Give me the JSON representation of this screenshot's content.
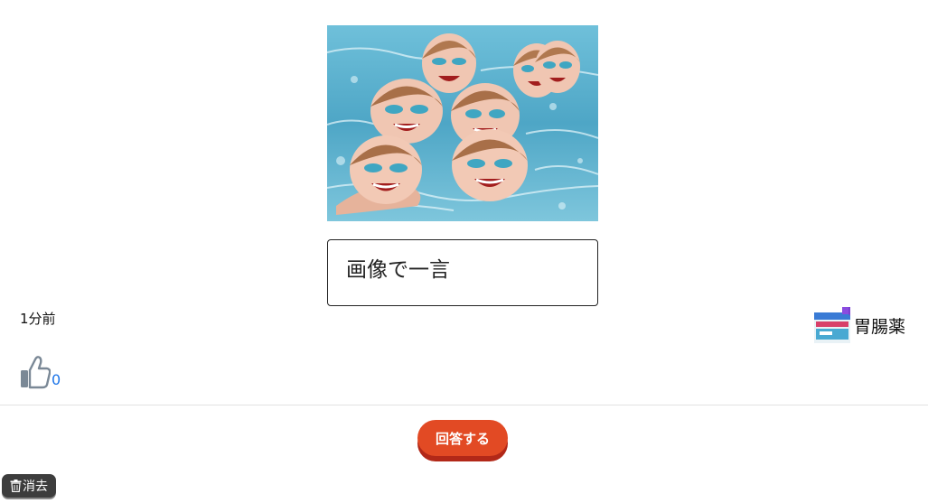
{
  "post": {
    "photo_alt": "synchronized swimmers",
    "caption_placeholder": "画像で一言",
    "time_ago": "1分前"
  },
  "user": {
    "name": "胃腸薬",
    "avatar_icon": "medicine-box-avatar"
  },
  "likes": {
    "icon": "thumbs-up-icon",
    "count": "0"
  },
  "actions": {
    "answer_label": "回答する",
    "delete_label": "消去"
  },
  "colors": {
    "accent": "#e24a24",
    "accent_shadow": "#b22818",
    "like_count": "#1a73e8",
    "delete_bg": "#3d3d3d"
  }
}
